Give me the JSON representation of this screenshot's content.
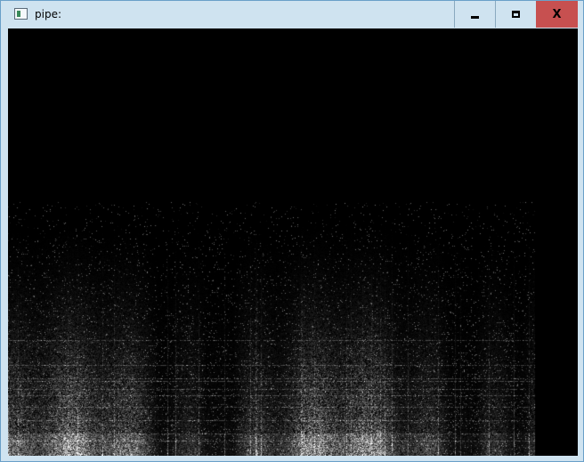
{
  "window": {
    "title": "pipe:",
    "controls": {
      "minimize": "minimize",
      "maximize": "maximize",
      "close": "X"
    }
  },
  "icons": {
    "app": "app-window-icon",
    "minimize": "minimize-icon",
    "maximize": "maximize-icon",
    "close": "close-icon"
  },
  "colors": {
    "titlebar": "#cfe3f0",
    "close_button": "#c75050",
    "canvas_background": "#000000",
    "spectrum": "#ffffff"
  },
  "content": {
    "kind": "spectrogram"
  }
}
